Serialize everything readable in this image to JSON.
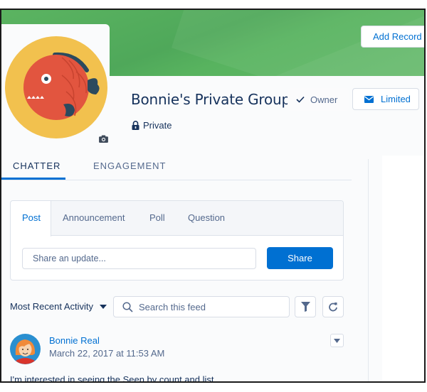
{
  "header": {
    "add_record_label": "Add Record",
    "group_name": "Bonnie's Private Group",
    "privacy_label": "Private",
    "owner_label": "Owner",
    "limited_label": "Limited"
  },
  "colors": {
    "banner_green": "#58b35f",
    "brand_blue": "#0070d2",
    "text_dark": "#16325c",
    "text_muted": "#54698d",
    "avatar_yellow": "#f2c14e",
    "fish_red": "#e2553f",
    "fish_fin": "#2b4a5e"
  },
  "tabs": [
    {
      "label": "CHATTER",
      "active": true
    },
    {
      "label": "ENGAGEMENT",
      "active": false
    }
  ],
  "publisher": {
    "tabs": [
      {
        "label": "Post",
        "active": true
      },
      {
        "label": "Announcement",
        "active": false
      },
      {
        "label": "Poll",
        "active": false
      },
      {
        "label": "Question",
        "active": false
      }
    ],
    "input_placeholder": "Share an update...",
    "share_label": "Share"
  },
  "feed": {
    "sort_label": "Most Recent Activity",
    "search_placeholder": "Search this feed",
    "filter_icon": "filter-icon",
    "refresh_icon": "refresh-icon",
    "posts": [
      {
        "author": "Bonnie Real",
        "timestamp": "March 22, 2017 at 11:53 AM",
        "body": "I'm interested in seeing the Seen by count and list."
      }
    ]
  }
}
